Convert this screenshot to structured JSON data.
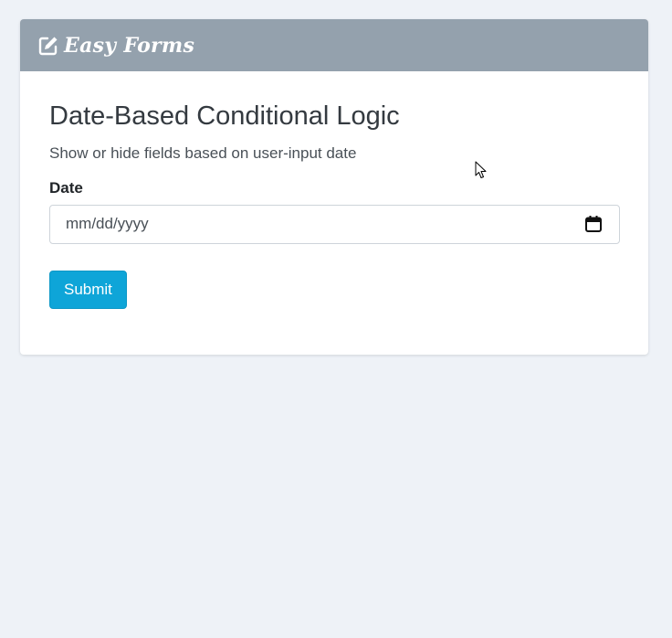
{
  "header": {
    "brand_icon": "edit-square-icon",
    "brand_title": "Easy Forms"
  },
  "form": {
    "title": "Date-Based Conditional Logic",
    "description": "Show or hide fields based on user-input date",
    "date_field": {
      "label": "Date",
      "placeholder": "mm/dd/yyyy",
      "icon": "calendar-icon"
    },
    "submit_label": "Submit"
  },
  "colors": {
    "header_bg": "#94a1ad",
    "page_bg": "#eef2f7",
    "submit_bg": "#0ea5d8"
  },
  "cursor": {
    "icon": "mouse-pointer-icon"
  }
}
